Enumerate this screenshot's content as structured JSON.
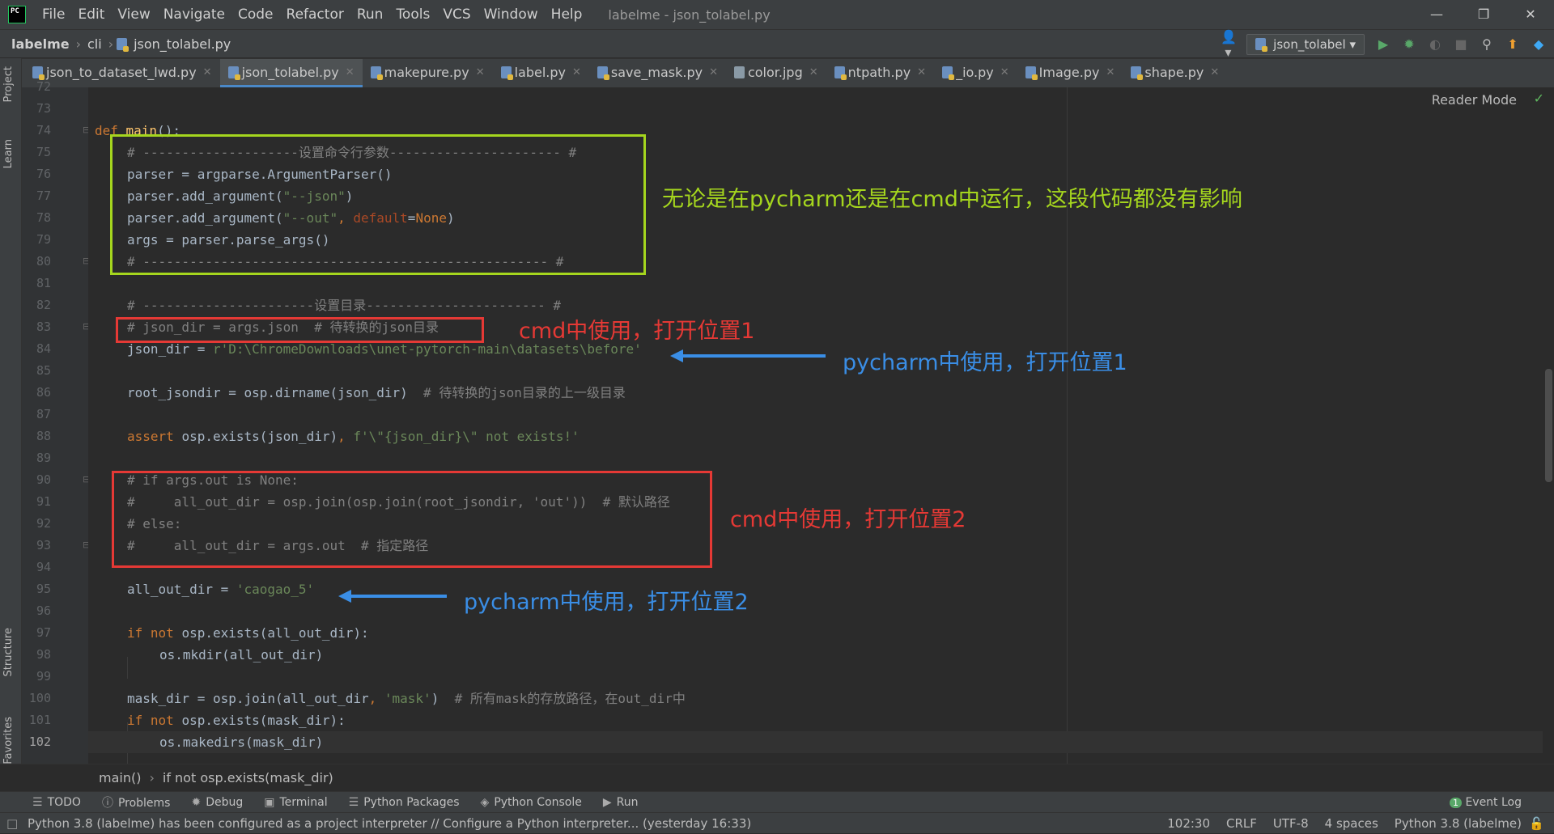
{
  "menubar": {
    "items": [
      "File",
      "Edit",
      "View",
      "Navigate",
      "Code",
      "Refactor",
      "Run",
      "Tools",
      "VCS",
      "Window",
      "Help"
    ],
    "title": "labelme - json_tolabel.py"
  },
  "navbar": {
    "crumbs": [
      "labelme",
      "cli",
      "json_tolabel.py"
    ],
    "run_config": "json_tolabel"
  },
  "tabs": [
    {
      "label": "json_to_dataset_lwd.py",
      "active": false,
      "icon": "python-file-icon"
    },
    {
      "label": "json_tolabel.py",
      "active": true,
      "icon": "python-file-icon"
    },
    {
      "label": "makepure.py",
      "active": false,
      "icon": "python-file-icon"
    },
    {
      "label": "label.py",
      "active": false,
      "icon": "python-file-icon"
    },
    {
      "label": "save_mask.py",
      "active": false,
      "icon": "python-file-icon"
    },
    {
      "label": "color.jpg",
      "active": false,
      "icon": "image-file-icon"
    },
    {
      "label": "ntpath.py",
      "active": false,
      "icon": "python-file-icon"
    },
    {
      "label": "_io.py",
      "active": false,
      "icon": "python-file-icon"
    },
    {
      "label": "Image.py",
      "active": false,
      "icon": "python-file-icon"
    },
    {
      "label": "shape.py",
      "active": false,
      "icon": "python-file-icon"
    }
  ],
  "left_tool_tabs": [
    "Project",
    "Learn",
    "Structure",
    "Favorites"
  ],
  "editor": {
    "reader_mode": "Reader Mode",
    "line_numbers": [
      "72",
      "73",
      "74",
      "75",
      "76",
      "77",
      "78",
      "79",
      "80",
      "81",
      "82",
      "83",
      "84",
      "85",
      "86",
      "87",
      "88",
      "89",
      "90",
      "91",
      "92",
      "93",
      "94",
      "95",
      "96",
      "97",
      "98",
      "99",
      "100",
      "101",
      "102"
    ],
    "current_line": "102"
  },
  "code": {
    "l74": {
      "kw": "def ",
      "fn": "main",
      "rest": "():"
    },
    "l75": "# --------------------设置命令行参数---------------------- #",
    "l76": "parser = argparse.ArgumentParser()",
    "l77": {
      "a": "parser.add_argument(",
      "s": "\"--json\"",
      "b": ")"
    },
    "l78": {
      "a": "parser.add_argument(",
      "s": "\"--out\"",
      "c": ", ",
      "k": "default",
      "d": "=",
      "n": "None",
      "e": ")"
    },
    "l79": "args = parser.parse_args()",
    "l80": "# ---------------------------------------------------- #",
    "l82": "# ----------------------设置目录----------------------- #",
    "l83": "# json_dir = args.json  # 待转换的json目录",
    "l84": {
      "a": "json_dir = ",
      "s": "r'D:\\ChromeDownloads\\unet-pytorch-main\\datasets\\before'"
    },
    "l86": {
      "a": "root_jsondir = osp.dirname(json_dir)  ",
      "c": "# 待转换的json目录的上一级目录"
    },
    "l88": {
      "kw": "assert ",
      "a": "osp.exists(json_dir)",
      "c": ", ",
      "s": "f'\\\"{json_dir}\\\" not exists!'"
    },
    "l90": "# if args.out is None:",
    "l91": "#     all_out_dir = osp.join(osp.join(root_jsondir, 'out'))  # 默认路径",
    "l92": "# else:",
    "l93": "#     all_out_dir = args.out  # 指定路径",
    "l95": {
      "a": "all_out_dir = ",
      "s": "'caogao_5'"
    },
    "l97": {
      "kw": "if not ",
      "a": "osp.exists(all_out_dir):"
    },
    "l98": "os.mkdir(all_out_dir)",
    "l100": {
      "a": "mask_dir = osp.join(all_out_dir",
      "c": ", ",
      "s": "'mask'",
      "b": ")  ",
      "cm": "# 所有mask的存放路径，在out_dir中"
    },
    "l101": {
      "kw": "if not ",
      "a": "osp.exists(mask_dir):"
    },
    "l102": "os.makedirs(mask_dir)"
  },
  "annotations": {
    "green_note": "无论是在pycharm还是在cmd中运行，这段代码都没有影响",
    "cmd1": "cmd中使用，打开位置1",
    "pycharm1": "pycharm中使用，打开位置1",
    "cmd2": "cmd中使用，打开位置2",
    "pycharm2": "pycharm中使用，打开位置2",
    "colors": {
      "green": "#a5d61e",
      "red": "#e53935",
      "blue": "#3a8ee6"
    }
  },
  "breadcrumb": [
    "main()",
    "if not osp.exists(mask_dir)"
  ],
  "tool_windows": [
    "TODO",
    "Problems",
    "Debug",
    "Terminal",
    "Python Packages",
    "Python Console",
    "Run"
  ],
  "event_log": {
    "count": "1",
    "label": "Event Log"
  },
  "status": {
    "message": "Python 3.8 (labelme) has been configured as a project interpreter // Configure a Python interpreter... (yesterday 16:33)",
    "position": "102:30",
    "line_sep": "CRLF",
    "encoding": "UTF-8",
    "indent": "4 spaces",
    "interpreter": "Python 3.8 (labelme)"
  }
}
